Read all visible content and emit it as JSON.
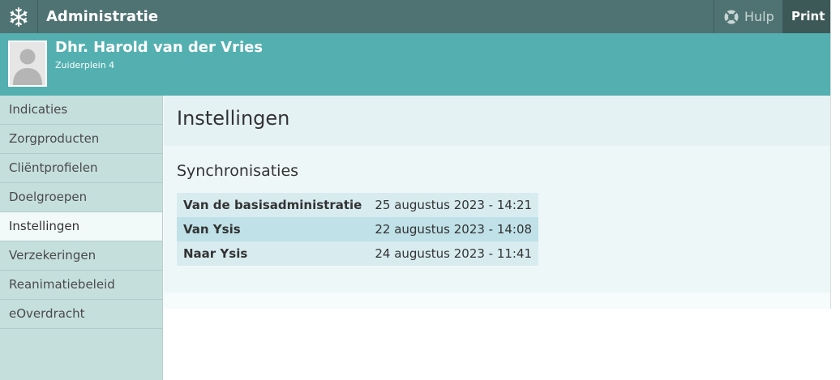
{
  "app": {
    "title": "Administratie"
  },
  "toolbar": {
    "help_label": "Hulp",
    "print_label": "Print"
  },
  "patient": {
    "name": "Dhr. Harold van der Vries",
    "address": "Zuiderplein 4"
  },
  "sidebar": {
    "items": [
      {
        "label": "Indicaties",
        "active": false
      },
      {
        "label": "Zorgproducten",
        "active": false
      },
      {
        "label": "Cliëntprofielen",
        "active": false
      },
      {
        "label": "Doelgroepen",
        "active": false
      },
      {
        "label": "Instellingen",
        "active": true
      },
      {
        "label": "Verzekeringen",
        "active": false
      },
      {
        "label": "Reanimatiebeleid",
        "active": false
      },
      {
        "label": "eOverdracht",
        "active": false
      }
    ]
  },
  "main": {
    "title": "Instellingen",
    "section_title": "Synchronisaties",
    "sync_rows": [
      {
        "label": "Van de basisadministratie",
        "value": "25 augustus 2023 - 14:21"
      },
      {
        "label": "Van Ysis",
        "value": "22 augustus 2023 - 14:08"
      },
      {
        "label": "Naar Ysis",
        "value": "24 augustus 2023 - 11:41"
      }
    ]
  },
  "icons": {
    "logo": "snowflake-logo-icon",
    "help": "lifebuoy-icon",
    "avatar": "person-avatar-icon"
  },
  "colors": {
    "topbar": "#4f7372",
    "patient_bar": "#54b0b0",
    "sidebar": "#c5dfdd",
    "active_item": "#f2f9f9"
  }
}
